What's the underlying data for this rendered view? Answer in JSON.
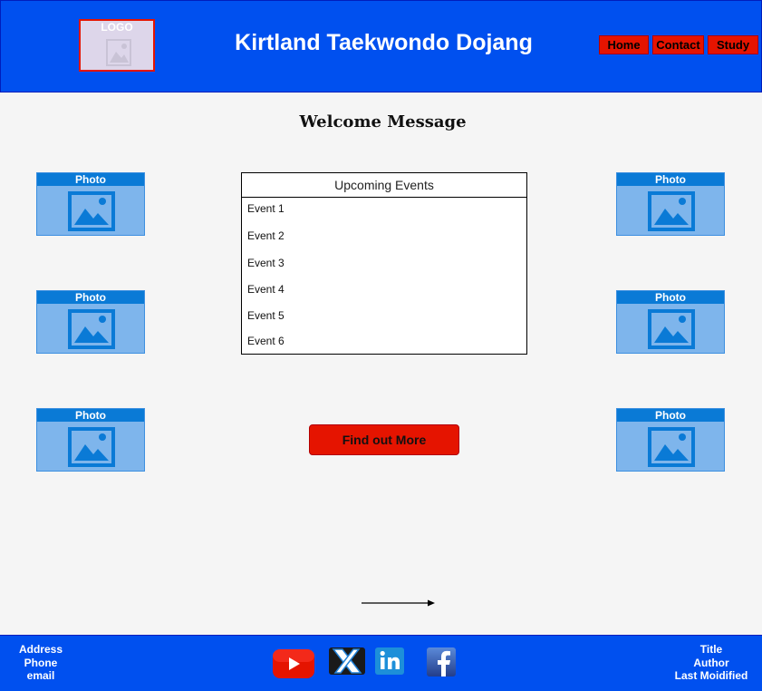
{
  "header": {
    "logo_label": "LOGO",
    "title": "Kirtland Taekwondo Dojang",
    "nav": [
      "Home",
      "Contact",
      "Study"
    ]
  },
  "main": {
    "welcome": "Welcome Message",
    "photo_label": "Photo",
    "events": {
      "header": "Upcoming Events",
      "items": [
        "Event 1",
        "Event 2",
        "Event 3",
        "Event 4",
        "Event 5",
        "Event 6"
      ]
    },
    "cta_label": "Find out More"
  },
  "footer": {
    "left": [
      "Address",
      "Phone",
      "email"
    ],
    "right": [
      "Title",
      "Author",
      "Last Moidified"
    ],
    "social_icons": [
      "youtube-icon",
      "x-icon",
      "linkedin-icon",
      "facebook-icon"
    ]
  },
  "colors": {
    "header_bg": "#0050ef",
    "nav_button": "#e51400",
    "photo_bg": "#7eb5ec",
    "photo_bar": "#0a7ad6"
  }
}
